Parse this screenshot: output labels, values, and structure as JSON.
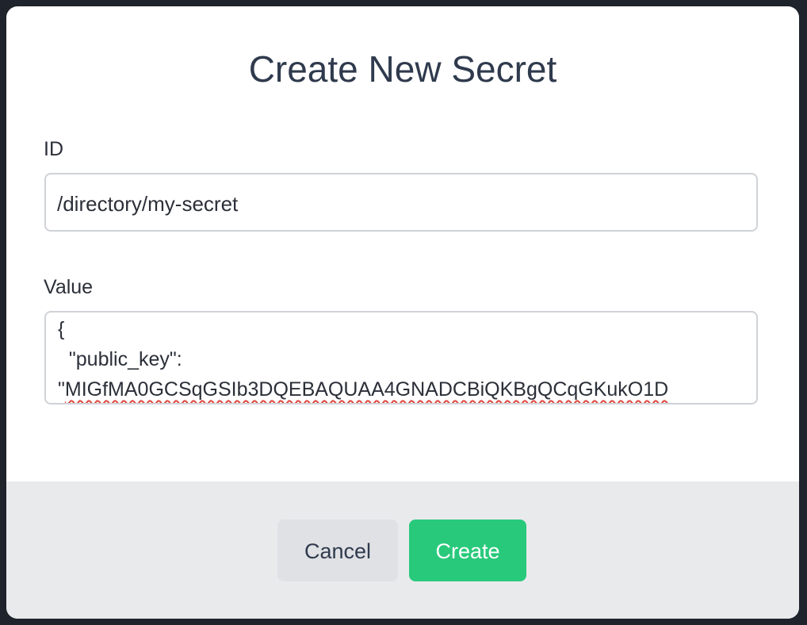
{
  "dialog": {
    "title": "Create New Secret"
  },
  "fields": {
    "id": {
      "label": "ID",
      "value": "/directory/my-secret"
    },
    "value": {
      "label": "Value",
      "lines": [
        "{",
        "  \"public_key\":",
        "\"MIGfMA0GCSqGSIb3DQEBAQUAA4GNADCBiQKBgQCqGKukO1D"
      ],
      "line3_quote": "\"",
      "line3_token": "MIGfMA0GCSqGSIb3DQEBAQUAA4GNADCBiQKBgQCqGKukO1D"
    }
  },
  "footer": {
    "cancel_label": "Cancel",
    "create_label": "Create",
    "create_color": "#28c97b"
  }
}
